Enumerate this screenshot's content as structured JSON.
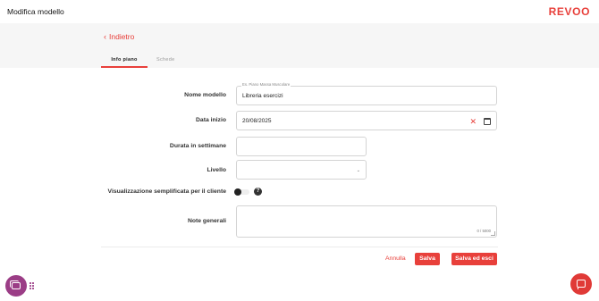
{
  "header": {
    "title": "Modifica modello",
    "logo": "REVOO"
  },
  "nav": {
    "back_label": "Indietro"
  },
  "tabs": [
    {
      "label": "Info piano",
      "active": true
    },
    {
      "label": "Schede",
      "active": false
    }
  ],
  "form": {
    "nome_modello": {
      "label": "Nome modello",
      "hint": "Es. Piano Massa Muscolare",
      "value": "Libreria esercizi"
    },
    "data_inizio": {
      "label": "Data inizio",
      "value": "20/08/2025"
    },
    "durata": {
      "label": "Durata in settimane",
      "value": ""
    },
    "livello": {
      "label": "Livello",
      "value": ""
    },
    "visualizzazione": {
      "label": "Visualizzazione semplificata per il cliente",
      "enabled": false
    },
    "note": {
      "label": "Note generali",
      "value": "",
      "counter": "0 / 5000"
    }
  },
  "actions": {
    "cancel": "Annulla",
    "save": "Salva",
    "save_exit": "Salva ed esci"
  },
  "colors": {
    "accent": "#e8403b",
    "chat_left": "#9b3d86",
    "chat_right": "#e03a37"
  },
  "icons": [
    "chevron-left-icon",
    "clear-icon",
    "calendar-icon",
    "chevron-down-icon",
    "help-icon",
    "chat-icon",
    "drag-handle-icon",
    "message-icon"
  ]
}
